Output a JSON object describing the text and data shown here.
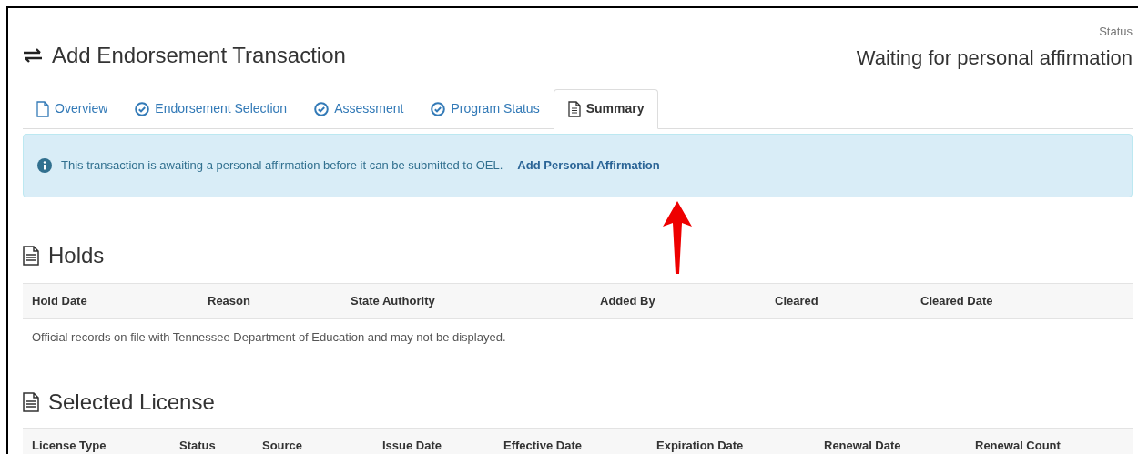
{
  "header": {
    "title": "Add Endorsement Transaction",
    "status_label": "Status",
    "status_value": "Waiting for personal affirmation"
  },
  "tabs": [
    {
      "label": "Overview",
      "kind": "document",
      "selected": false
    },
    {
      "label": "Endorsement Selection",
      "kind": "check",
      "selected": false
    },
    {
      "label": "Assessment",
      "kind": "check",
      "selected": false
    },
    {
      "label": "Program Status",
      "kind": "check",
      "selected": false
    },
    {
      "label": "Summary",
      "kind": "document",
      "selected": true
    }
  ],
  "alert": {
    "message": "This transaction is awaiting a personal affirmation before it can be submitted to OEL.",
    "link": "Add Personal Affirmation"
  },
  "holds": {
    "title": "Holds",
    "columns": [
      "Hold Date",
      "Reason",
      "State Authority",
      "Added By",
      "Cleared",
      "Cleared Date"
    ],
    "empty_message": "Official records on file with Tennessee Department of Education and may not be displayed."
  },
  "selected_license": {
    "title": "Selected License",
    "columns": [
      "License Type",
      "Status",
      "Source",
      "Issue Date",
      "Effective Date",
      "Expiration Date",
      "Renewal Date",
      "Renewal Count"
    ]
  }
}
